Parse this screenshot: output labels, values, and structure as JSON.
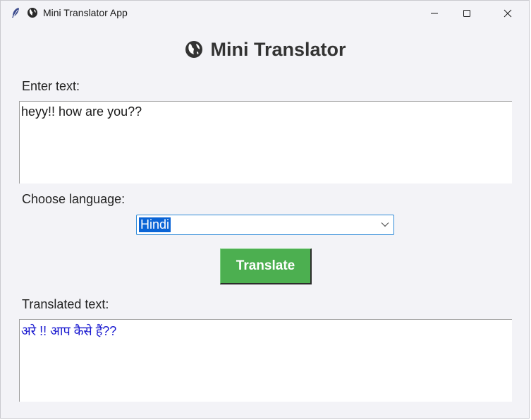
{
  "window": {
    "title": "Mini Translator App"
  },
  "icons": {
    "app": "feather-icon",
    "title_globe": "globe-icon",
    "minimize": "minimize-icon",
    "maximize": "maximize-icon",
    "close": "close-icon",
    "dropdown": "chevron-down-icon"
  },
  "heading": "Mini Translator",
  "input": {
    "label": "Enter text:",
    "value": "heyy!! how are you??"
  },
  "language": {
    "label": "Choose language:",
    "selected": "Hindi"
  },
  "translate_button": "Translate",
  "output": {
    "label": "Translated text:",
    "value": "अरे !! आप कैसे हैं??"
  },
  "colors": {
    "button": "#4caf50",
    "selection": "#0a64d6",
    "output_text": "#1a1ad0",
    "background": "#f3f3f7"
  }
}
